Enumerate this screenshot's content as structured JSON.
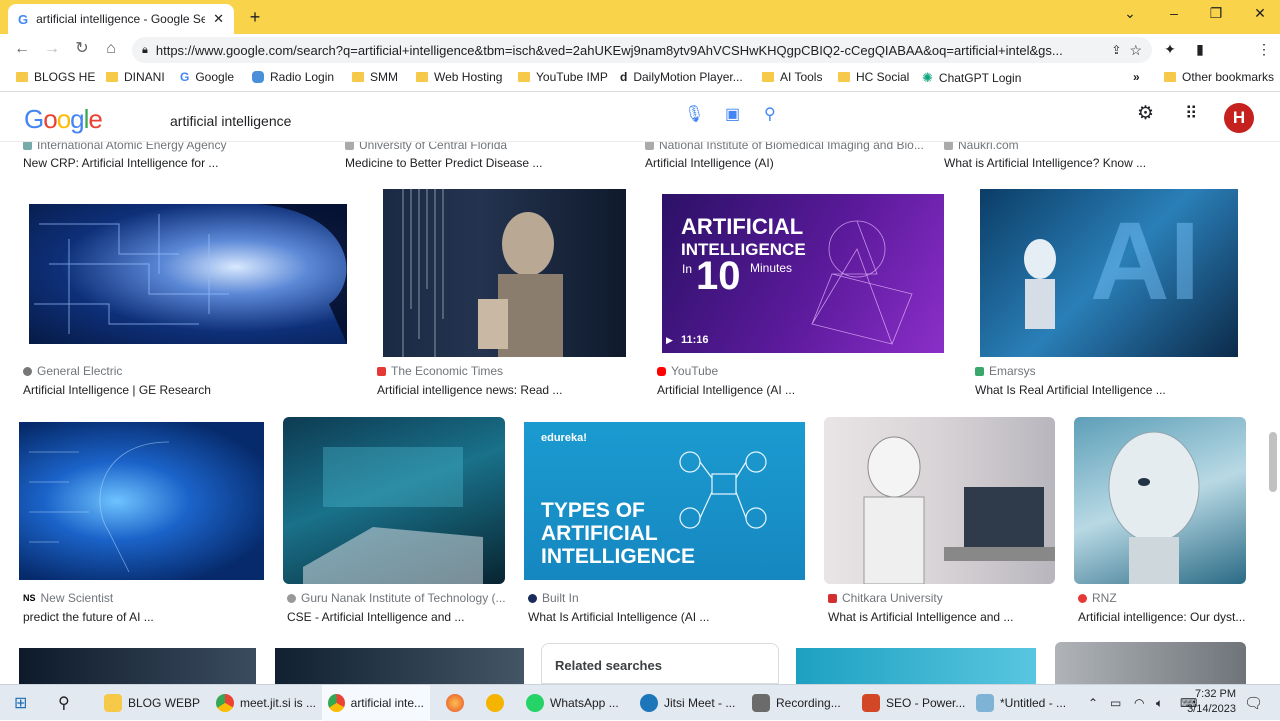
{
  "browser": {
    "tab_title": "artificial intelligence - Google Se",
    "url": "https://www.google.com/search?q=artificial+intelligence&tbm=isch&ved=2ahUKEwj9nam8ytv9AhVCSHwKHQgpCBIQ2-cCegQIABAA&oq=artificial+intel&gs...",
    "profile_initial": "H"
  },
  "bookmarks": [
    {
      "label": "BLOGS HE",
      "icon": "folder-icon"
    },
    {
      "label": "DINANI",
      "icon": "folder-icon"
    },
    {
      "label": "Google",
      "icon": "google-icon"
    },
    {
      "label": "Radio Login",
      "icon": "radio-icon"
    },
    {
      "label": "SMM",
      "icon": "folder-icon"
    },
    {
      "label": "Web Hosting",
      "icon": "folder-icon"
    },
    {
      "label": "YouTube IMP",
      "icon": "folder-icon"
    },
    {
      "label": "DailyMotion Player...",
      "icon": "dailymotion-icon"
    },
    {
      "label": "AI Tools",
      "icon": "folder-icon"
    },
    {
      "label": "HC Social",
      "icon": "folder-icon"
    },
    {
      "label": "ChatGPT Login",
      "icon": "chatgpt-icon"
    }
  ],
  "other_bookmarks": "Other bookmarks",
  "search": {
    "logo": "Google",
    "query": "artificial intelligence"
  },
  "row0": [
    {
      "source": "International Atomic Energy Agency",
      "caption": "New CRP: Artificial Intelligence for ..."
    },
    {
      "source": "University of Central Florida",
      "caption": "Medicine to Better Predict Disease ..."
    },
    {
      "source": "National Institute of Biomedical Imaging and Bio...",
      "caption": "Artificial Intelligence (AI)"
    },
    {
      "source": "Naukri.com",
      "caption": "What is Artificial Intelligence? Know ..."
    }
  ],
  "row1": [
    {
      "source": "General Electric",
      "caption": "Artificial Intelligence | GE Research"
    },
    {
      "source": "The Economic Times",
      "caption": "Artificial intelligence news: Read ..."
    },
    {
      "source": "YouTube",
      "caption": "Artificial Intelligence (AI ..."
    },
    {
      "source": "Emarsys",
      "caption": "What Is Real Artificial Intelligence ..."
    }
  ],
  "video_thumb": {
    "line1": "ARTIFICIAL",
    "line2": "INTELLIGENCE",
    "line3": "In",
    "big": "10",
    "line4": "Minutes",
    "duration": "11:16"
  },
  "row2": [
    {
      "source": "New Scientist",
      "caption": "predict the future of AI ..."
    },
    {
      "source": "Guru Nanak Institute of Technology (...",
      "caption": "CSE - Artificial Intelligence and ..."
    },
    {
      "source": "Built In",
      "caption": "What Is Artificial Intelligence (AI ..."
    },
    {
      "source": "Chitkara University",
      "caption": "What is Artificial Intelligence and ..."
    },
    {
      "source": "RNZ",
      "caption": "Artificial intelligence: Our dyst..."
    }
  ],
  "edureka": {
    "brand": "edureka!",
    "line1": "TYPES OF",
    "line2": "ARTIFICIAL",
    "line3": "INTELLIGENCE"
  },
  "related_searches": "Related searches",
  "taskbar": [
    {
      "label": "BLOG WEBP"
    },
    {
      "label": "meet.jit.si is ..."
    },
    {
      "label": "artificial inte..."
    },
    {
      "label": "WhatsApp ..."
    },
    {
      "label": "Jitsi Meet - ..."
    },
    {
      "label": "Recording..."
    },
    {
      "label": "SEO - Power..."
    },
    {
      "label": "*Untitled - ..."
    }
  ],
  "clock": {
    "time": "7:32 PM",
    "date": "3/14/2023"
  },
  "colors": {
    "titlebar": "#f9d44b",
    "link_blue": "#1a73e8",
    "taskbar": "#e3e9f1"
  }
}
